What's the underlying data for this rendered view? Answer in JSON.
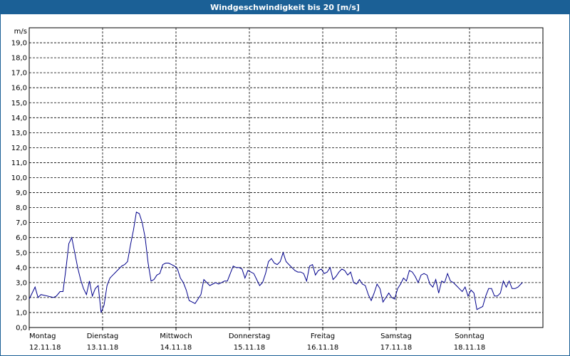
{
  "window": {
    "title": "Windgeschwindigkeit bis 20 [m/s]"
  },
  "colors": {
    "titlebar": "#1b6096",
    "line": "#00008b",
    "grid": "#000000"
  },
  "chart_data": {
    "type": "line",
    "title": "Windgeschwindigkeit bis 20 [m/s]",
    "ylabel": "m/s",
    "ylim": [
      0,
      20
    ],
    "yticks": [
      "0,0",
      "1,0",
      "2,0",
      "3,0",
      "4,0",
      "5,0",
      "6,0",
      "7,0",
      "8,0",
      "9,0",
      "10,0",
      "11,0",
      "12,0",
      "13,0",
      "14,0",
      "15,0",
      "16,0",
      "17,0",
      "18,0",
      "19,0"
    ],
    "x_days": [
      {
        "day": "Montag",
        "date": "12.11.18"
      },
      {
        "day": "Dienstag",
        "date": "13.11.18"
      },
      {
        "day": "Mittwoch",
        "date": "14.11.18"
      },
      {
        "day": "Donnerstag",
        "date": "15.11.18"
      },
      {
        "day": "Freitag",
        "date": "16.11.18"
      },
      {
        "day": "Samstag",
        "date": "17.11.18"
      },
      {
        "day": "Sonntag",
        "date": "18.11.18"
      }
    ],
    "grid": true,
    "x_unit": "days since 12.11.18 00:00",
    "series": [
      {
        "name": "",
        "points": [
          [
            0.0,
            1.9
          ],
          [
            0.04,
            2.3
          ],
          [
            0.08,
            2.7
          ],
          [
            0.12,
            2.0
          ],
          [
            0.16,
            2.2
          ],
          [
            0.25,
            2.1
          ],
          [
            0.33,
            2.0
          ],
          [
            0.37,
            2.1
          ],
          [
            0.42,
            2.4
          ],
          [
            0.46,
            2.4
          ],
          [
            0.5,
            3.9
          ],
          [
            0.54,
            5.6
          ],
          [
            0.58,
            6.0
          ],
          [
            0.62,
            5.0
          ],
          [
            0.66,
            4.0
          ],
          [
            0.7,
            3.2
          ],
          [
            0.74,
            2.6
          ],
          [
            0.78,
            2.2
          ],
          [
            0.82,
            3.1
          ],
          [
            0.86,
            2.1
          ],
          [
            0.9,
            2.6
          ],
          [
            0.94,
            2.8
          ],
          [
            0.98,
            1.0
          ],
          [
            1.02,
            1.5
          ],
          [
            1.06,
            2.8
          ],
          [
            1.1,
            3.3
          ],
          [
            1.14,
            3.5
          ],
          [
            1.18,
            3.7
          ],
          [
            1.22,
            3.9
          ],
          [
            1.26,
            4.1
          ],
          [
            1.3,
            4.2
          ],
          [
            1.34,
            4.4
          ],
          [
            1.38,
            5.5
          ],
          [
            1.42,
            6.5
          ],
          [
            1.46,
            7.7
          ],
          [
            1.5,
            7.6
          ],
          [
            1.54,
            7.0
          ],
          [
            1.58,
            6.0
          ],
          [
            1.62,
            4.3
          ],
          [
            1.66,
            3.1
          ],
          [
            1.7,
            3.2
          ],
          [
            1.74,
            3.5
          ],
          [
            1.78,
            3.6
          ],
          [
            1.82,
            4.2
          ],
          [
            1.86,
            4.3
          ],
          [
            1.9,
            4.3
          ],
          [
            1.94,
            4.2
          ],
          [
            1.98,
            4.1
          ],
          [
            2.02,
            3.9
          ],
          [
            2.06,
            3.3
          ],
          [
            2.1,
            3.0
          ],
          [
            2.14,
            2.5
          ],
          [
            2.18,
            1.8
          ],
          [
            2.22,
            1.7
          ],
          [
            2.26,
            1.6
          ],
          [
            2.3,
            1.9
          ],
          [
            2.34,
            2.2
          ],
          [
            2.38,
            3.2
          ],
          [
            2.42,
            3.0
          ],
          [
            2.46,
            2.8
          ],
          [
            2.5,
            2.9
          ],
          [
            2.54,
            3.0
          ],
          [
            2.58,
            2.9
          ],
          [
            2.62,
            3.0
          ],
          [
            2.66,
            3.1
          ],
          [
            2.7,
            3.1
          ],
          [
            2.74,
            3.6
          ],
          [
            2.78,
            4.1
          ],
          [
            2.82,
            4.0
          ],
          [
            2.86,
            4.0
          ],
          [
            2.9,
            3.9
          ],
          [
            2.94,
            3.3
          ],
          [
            2.98,
            3.8
          ],
          [
            3.02,
            3.7
          ],
          [
            3.06,
            3.6
          ],
          [
            3.1,
            3.2
          ],
          [
            3.14,
            2.8
          ],
          [
            3.18,
            3.0
          ],
          [
            3.22,
            3.6
          ],
          [
            3.26,
            4.4
          ],
          [
            3.3,
            4.6
          ],
          [
            3.34,
            4.3
          ],
          [
            3.38,
            4.2
          ],
          [
            3.42,
            4.4
          ],
          [
            3.46,
            5.0
          ],
          [
            3.5,
            4.4
          ],
          [
            3.54,
            4.2
          ],
          [
            3.58,
            4.0
          ],
          [
            3.62,
            3.8
          ],
          [
            3.66,
            3.7
          ],
          [
            3.7,
            3.7
          ],
          [
            3.74,
            3.6
          ],
          [
            3.78,
            3.1
          ],
          [
            3.82,
            4.1
          ],
          [
            3.86,
            4.2
          ],
          [
            3.9,
            3.5
          ],
          [
            3.94,
            3.8
          ],
          [
            3.98,
            3.9
          ],
          [
            4.02,
            3.6
          ],
          [
            4.06,
            3.7
          ],
          [
            4.1,
            4.0
          ],
          [
            4.14,
            3.2
          ],
          [
            4.18,
            3.4
          ],
          [
            4.22,
            3.7
          ],
          [
            4.26,
            3.9
          ],
          [
            4.3,
            3.8
          ],
          [
            4.34,
            3.5
          ],
          [
            4.38,
            3.7
          ],
          [
            4.42,
            3.0
          ],
          [
            4.46,
            2.9
          ],
          [
            4.5,
            3.2
          ],
          [
            4.54,
            2.9
          ],
          [
            4.58,
            2.8
          ],
          [
            4.62,
            2.2
          ],
          [
            4.66,
            1.8
          ],
          [
            4.7,
            2.3
          ],
          [
            4.74,
            2.9
          ],
          [
            4.78,
            2.6
          ],
          [
            4.82,
            1.7
          ],
          [
            4.86,
            2.0
          ],
          [
            4.9,
            2.3
          ],
          [
            4.94,
            2.0
          ],
          [
            4.98,
            1.9
          ],
          [
            5.02,
            2.6
          ],
          [
            5.06,
            2.9
          ],
          [
            5.1,
            3.3
          ],
          [
            5.14,
            3.1
          ],
          [
            5.18,
            3.8
          ],
          [
            5.22,
            3.7
          ],
          [
            5.26,
            3.4
          ],
          [
            5.3,
            3.0
          ],
          [
            5.34,
            3.5
          ],
          [
            5.38,
            3.6
          ],
          [
            5.42,
            3.5
          ],
          [
            5.46,
            2.9
          ],
          [
            5.5,
            2.7
          ],
          [
            5.54,
            3.2
          ],
          [
            5.58,
            2.3
          ],
          [
            5.62,
            3.1
          ],
          [
            5.66,
            3.0
          ],
          [
            5.7,
            3.6
          ],
          [
            5.74,
            3.1
          ],
          [
            5.78,
            3.0
          ],
          [
            5.82,
            2.8
          ],
          [
            5.86,
            2.6
          ],
          [
            5.9,
            2.4
          ],
          [
            5.94,
            2.7
          ],
          [
            5.98,
            2.1
          ],
          [
            6.02,
            2.5
          ],
          [
            6.06,
            2.3
          ],
          [
            6.1,
            1.2
          ],
          [
            6.14,
            1.3
          ],
          [
            6.18,
            1.4
          ],
          [
            6.22,
            2.1
          ],
          [
            6.26,
            2.6
          ],
          [
            6.3,
            2.6
          ],
          [
            6.34,
            2.1
          ],
          [
            6.38,
            2.1
          ],
          [
            6.42,
            2.3
          ],
          [
            6.46,
            3.1
          ],
          [
            6.5,
            2.7
          ],
          [
            6.54,
            3.1
          ],
          [
            6.58,
            2.6
          ],
          [
            6.62,
            2.6
          ],
          [
            6.66,
            2.7
          ],
          [
            6.7,
            2.9
          ],
          [
            6.72,
            3.0
          ]
        ]
      }
    ]
  }
}
